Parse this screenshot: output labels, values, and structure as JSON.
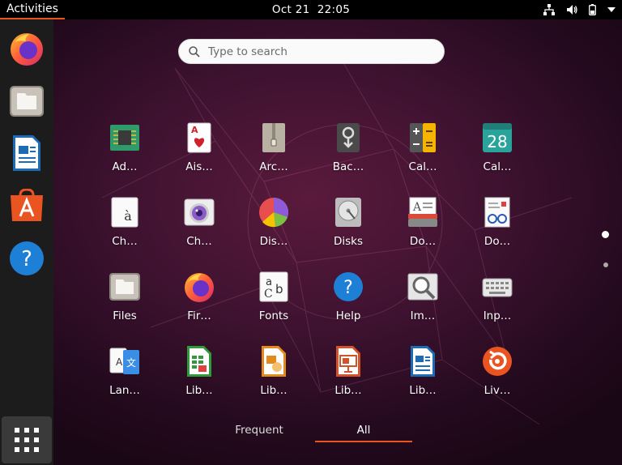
{
  "topbar": {
    "activities": "Activities",
    "date": "Oct 21",
    "time": "22:05"
  },
  "tray_icons": [
    "network-icon",
    "volume-icon",
    "battery-icon",
    "system-menu-arrow-icon"
  ],
  "dock": [
    {
      "name": "firefox-icon"
    },
    {
      "name": "files-icon"
    },
    {
      "name": "libreoffice-writer-icon"
    },
    {
      "name": "software-center-icon"
    },
    {
      "name": "help-icon"
    }
  ],
  "search": {
    "placeholder": "Type to search"
  },
  "apps": [
    {
      "label": "Ad…",
      "icon": "advanced-network-icon"
    },
    {
      "label": "Ais…",
      "icon": "aisleriot-cards-icon"
    },
    {
      "label": "Arc…",
      "icon": "archive-manager-icon"
    },
    {
      "label": "Bac…",
      "icon": "backups-icon"
    },
    {
      "label": "Cal…",
      "icon": "calculator-icon"
    },
    {
      "label": "Cal…",
      "icon": "calendar-icon",
      "text": "28"
    },
    {
      "label": "Ch…",
      "icon": "character-map-icon",
      "text": "à"
    },
    {
      "label": "Ch…",
      "icon": "cheese-icon"
    },
    {
      "label": "Dis…",
      "icon": "disk-usage-icon"
    },
    {
      "label": "Disks",
      "icon": "disks-icon"
    },
    {
      "label": "Do…",
      "icon": "document-scanner-icon"
    },
    {
      "label": "Do…",
      "icon": "document-viewer-icon"
    },
    {
      "label": "Files",
      "icon": "files-icon"
    },
    {
      "label": "Fir…",
      "icon": "firefox-icon"
    },
    {
      "label": "Fonts",
      "icon": "fonts-icon",
      "text": "a"
    },
    {
      "label": "Help",
      "icon": "help-icon",
      "text": "?"
    },
    {
      "label": "Im…",
      "icon": "image-viewer-icon"
    },
    {
      "label": "Inp…",
      "icon": "input-method-icon"
    },
    {
      "label": "Lan…",
      "icon": "language-support-icon",
      "text": "A"
    },
    {
      "label": "Lib…",
      "icon": "libreoffice-calc-icon"
    },
    {
      "label": "Lib…",
      "icon": "libreoffice-draw-icon"
    },
    {
      "label": "Lib…",
      "icon": "libreoffice-impress-icon"
    },
    {
      "label": "Lib…",
      "icon": "libreoffice-writer-icon"
    },
    {
      "label": "Liv…",
      "icon": "livepatch-icon"
    }
  ],
  "tabs": {
    "frequent": "Frequent",
    "all": "All",
    "active": "all"
  },
  "colors": {
    "accent": "#e95420",
    "topbar": "#000000",
    "dock": "#1c1c1c"
  }
}
